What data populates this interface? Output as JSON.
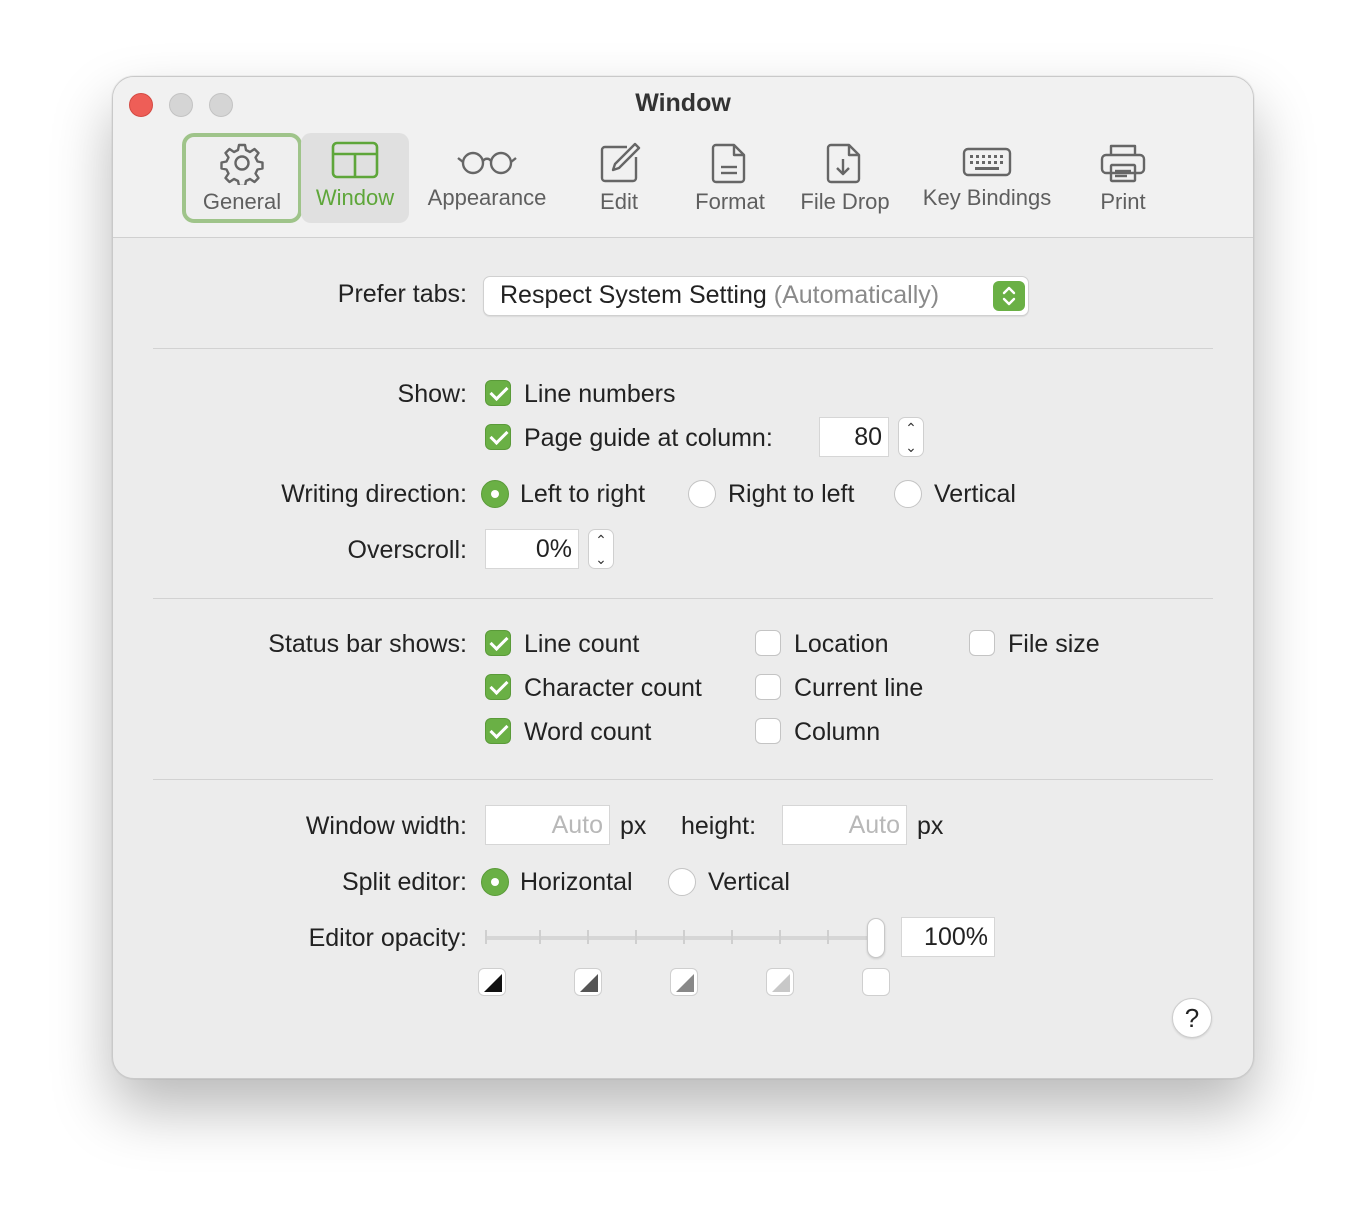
{
  "window": {
    "title": "Window"
  },
  "tabs": [
    {
      "label": "General",
      "icon": "gear-icon"
    },
    {
      "label": "Window",
      "icon": "window-layout-icon"
    },
    {
      "label": "Appearance",
      "icon": "glasses-icon"
    },
    {
      "label": "Edit",
      "icon": "square-pencil-icon"
    },
    {
      "label": "Format",
      "icon": "document-icon"
    },
    {
      "label": "File Drop",
      "icon": "document-arrow-icon"
    },
    {
      "label": "Key Bindings",
      "icon": "keyboard-icon"
    },
    {
      "label": "Print",
      "icon": "printer-icon"
    }
  ],
  "selected_tab": "Window",
  "prefer_tabs": {
    "label": "Prefer tabs:",
    "value": "Respect System Setting",
    "value_suffix": "(Automatically)"
  },
  "show": {
    "label": "Show:",
    "line_numbers": {
      "label": "Line numbers",
      "checked": true
    },
    "page_guide": {
      "label": "Page guide at column:",
      "checked": true,
      "column": "80"
    }
  },
  "writing_direction": {
    "label": "Writing direction:",
    "options": [
      "Left to right",
      "Right to left",
      "Vertical"
    ],
    "selected": "Left to right"
  },
  "overscroll": {
    "label": "Overscroll:",
    "value": "0%"
  },
  "status_bar": {
    "label": "Status bar shows:",
    "line_count": {
      "label": "Line count",
      "checked": true
    },
    "character_count": {
      "label": "Character count",
      "checked": true
    },
    "word_count": {
      "label": "Word count",
      "checked": true
    },
    "location": {
      "label": "Location",
      "checked": false
    },
    "current_line": {
      "label": "Current line",
      "checked": false
    },
    "column": {
      "label": "Column",
      "checked": false
    },
    "file_size": {
      "label": "File size",
      "checked": false
    }
  },
  "window_size": {
    "width_label": "Window width:",
    "width_placeholder": "Auto",
    "unit": "px",
    "height_label": "height:",
    "height_placeholder": "Auto"
  },
  "split_editor": {
    "label": "Split editor:",
    "options": [
      "Horizontal",
      "Vertical"
    ],
    "selected": "Horizontal"
  },
  "editor_opacity": {
    "label": "Editor opacity:",
    "value": "100%",
    "fraction": 1.0
  },
  "help_button": "?",
  "colors": {
    "accent": "#6ab045",
    "close": "#ee5e57"
  }
}
